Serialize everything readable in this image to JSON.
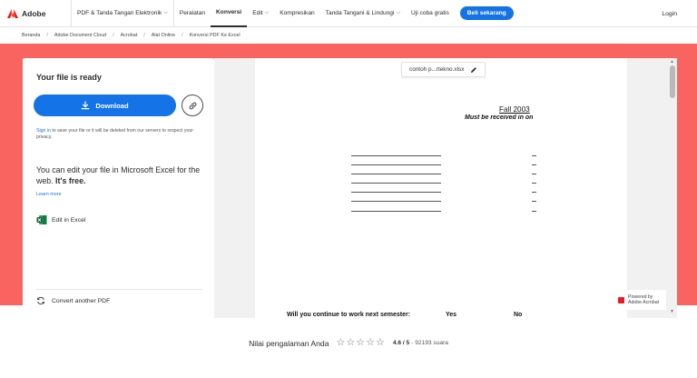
{
  "nav": {
    "logo_text": "Adobe",
    "items": [
      {
        "label": "PDF & Tanda Tangan Elektronik",
        "dropdown": true
      },
      {
        "label": "Peralatan",
        "dropdown": false
      },
      {
        "label": "Konversi",
        "dropdown": false,
        "active": true
      },
      {
        "label": "Edit",
        "dropdown": true
      },
      {
        "label": "Kompresikan",
        "dropdown": false
      },
      {
        "label": "Tanda Tangani & Lindungi",
        "dropdown": true
      },
      {
        "label": "Uji coba gratis",
        "dropdown": false
      }
    ],
    "cta_label": "Beli sekarang",
    "login_label": "Login",
    "brand_color": "#fa0f00",
    "cta_color": "#1473e6"
  },
  "breadcrumb": [
    "Beranda",
    "Adobe Document Cloud",
    "Acrobat",
    "Alat Online",
    "Konversi PDF Ke Excel"
  ],
  "panel": {
    "title": "Your file is ready",
    "download_label": "Download",
    "sign_link": "Sign in",
    "sign_note": " to save your file or it will be deleted from our servers to respect your privacy.",
    "edit_text": "You can edit your file in Microsoft Excel for the web. ",
    "edit_text_bold": "It's free.",
    "learn_more": "Learn more",
    "edit_in_excel": "Edit in Excel",
    "convert_another": "Convert another PDF",
    "band_color": "#fa6460"
  },
  "preview": {
    "file_name": "contoh p...rtekno.xlsx",
    "doc_title": "Fall 2003",
    "doc_subtitle": "Must be received in on",
    "question": "Will you continue to work next semester:",
    "yes": "Yes",
    "no": "No",
    "powered_line1": "Powered by",
    "powered_line2": "Adobe Acrobat"
  },
  "rating": {
    "label": "Nilai pengalaman Anda",
    "star_count": 5,
    "score": "4.6 / 5",
    "votes": " - 92193 suara"
  }
}
